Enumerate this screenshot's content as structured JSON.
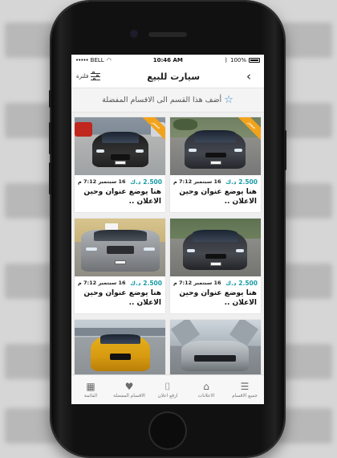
{
  "status_bar": {
    "carrier": "BELL",
    "time": "10:46 AM",
    "battery": "100%"
  },
  "header": {
    "title": "سيارت للبيع",
    "filter_label": "فلترة"
  },
  "favorite_banner": {
    "text": "أضف هذا القسم الى الاقسام المفضلة"
  },
  "listings": [
    {
      "price": "2.500 د.ك",
      "date": "16 سبتمبر 7:12 م",
      "title": "هنا يوضع عنوان وحين الاعلان ..",
      "badge": "مميز"
    },
    {
      "price": "2.500 د.ك",
      "date": "16 سبتمبر 7:12 م",
      "title": "هنا يوضع عنوان وحين الاعلان ..",
      "badge": "مميز"
    },
    {
      "price": "2.500 د.ك",
      "date": "16 سبتمبر 7:12 م",
      "title": "هنا يوضع عنوان وحين الاعلان ..",
      "badge": ""
    },
    {
      "price": "2.500 د.ك",
      "date": "16 سبتمبر 7:12 م",
      "title": "هنا يوضع عنوان وحين الاعلان ..",
      "badge": ""
    }
  ],
  "tabs": [
    {
      "label": "جميع الاقسام",
      "icon": "list-icon"
    },
    {
      "label": "الاعلانات",
      "icon": "tag-icon"
    },
    {
      "label": "ارفع اعلان",
      "icon": "camera-icon"
    },
    {
      "label": "الاقسام المفضلة",
      "icon": "heart-icon"
    },
    {
      "label": "القائمة",
      "icon": "menu-grid-icon"
    }
  ],
  "colors": {
    "accent": "#1a9aa6",
    "badge": "#f2a31b",
    "star": "#2e8bd6"
  }
}
